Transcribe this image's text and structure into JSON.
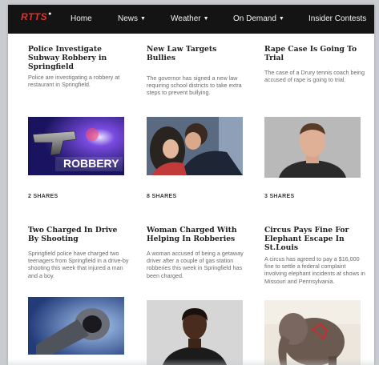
{
  "nav": {
    "logo": "RTTS",
    "items": [
      {
        "label": "Home",
        "dropdown": false
      },
      {
        "label": "News",
        "dropdown": true
      },
      {
        "label": "Weather",
        "dropdown": true
      },
      {
        "label": "On Demand",
        "dropdown": true
      },
      {
        "label": "Insider Contests",
        "dropdown": false
      }
    ],
    "chevron": "▼"
  },
  "articles": [
    {
      "title": "Police Investigate Subway Robbery in Springfield",
      "summary": "Police are investigating a robbery at restaurant in Springfield.",
      "image_icon": "robbery-gun-image",
      "image_caption": "ROBBERY",
      "shares": "2 SHARES"
    },
    {
      "title": "New Law Targets Bullies",
      "summary": "The governor has signed a new law requiring school districts to take extra steps to prevent bullying.",
      "image_icon": "bullying-photo",
      "shares": "8 SHARES"
    },
    {
      "title": "Rape Case Is Going To Trial",
      "summary": "The case of a Drury tennis coach being accused of rape is going to trial.",
      "image_icon": "mugshot-photo",
      "shares": "3 SHARES"
    },
    {
      "title": "Two Charged In Drive By Shooting",
      "summary": "Springfield police have charged two teenagers from Springfield in a drive-by shooting this week that injured a man and a boy.",
      "image_icon": "gun-barrel-photo"
    },
    {
      "title": "Woman Charged With Helping In Robberies",
      "summary": "A woman accused of being a getaway driver after a couple of gas station robberies this week in Springfield has been charged.",
      "image_icon": "woman-mugshot-photo"
    },
    {
      "title": "Circus Pays Fine For Elephant Escape In St.Louis",
      "summary": "A circus has agreed to pay a $16,000 fine to settle a federal complaint involving elephant incidents at shows in Missouri and Pennsylvania.",
      "image_icon": "elephant-photo"
    }
  ]
}
